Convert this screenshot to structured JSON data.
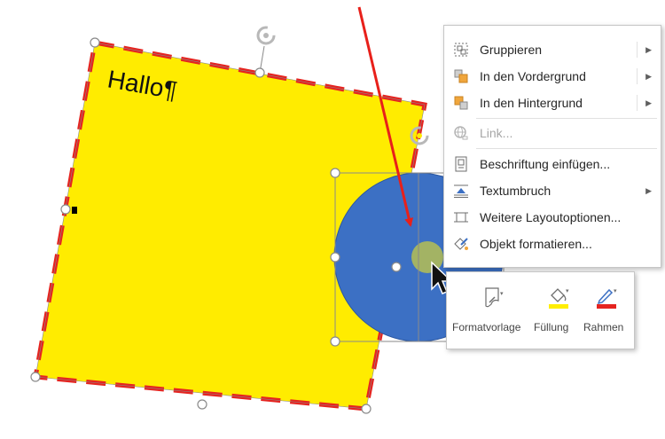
{
  "shape_text": "Hallo¶",
  "context_menu": {
    "items": [
      {
        "label": "Gruppieren",
        "submenu": true,
        "enabled": true
      },
      {
        "label": "In den Vordergrund",
        "submenu": true,
        "enabled": true
      },
      {
        "label": "In den Hintergrund",
        "submenu": true,
        "enabled": true
      },
      {
        "label": "Link...",
        "submenu": false,
        "enabled": false
      },
      {
        "label": "Beschriftung einfügen...",
        "submenu": false,
        "enabled": true
      },
      {
        "label": "Textumbruch",
        "submenu": true,
        "enabled": true
      },
      {
        "label": "Weitere Layoutoptionen...",
        "submenu": false,
        "enabled": true
      },
      {
        "label": "Objekt formatieren...",
        "submenu": false,
        "enabled": true
      }
    ]
  },
  "mini_toolbar": {
    "style_label": "Formatvorlage",
    "fill_label": "Füllung",
    "outline_label": "Rahmen"
  },
  "colors": {
    "square_fill": "#ffec00",
    "square_border": "#e52420",
    "circle_fill": "#3c70c4",
    "small_circle": "#a3b364",
    "arrow": "#e8201a",
    "fill_swatch": "#ffee00",
    "outline_swatch": "#e52420",
    "icon_orange": "#f0a63c",
    "icon_gray": "#6d6d6d"
  },
  "icons": {
    "rotate": "rotate-handle-icon",
    "group": "group-icon",
    "bring_forward": "bring-forward-icon",
    "send_backward": "send-backward-icon",
    "link": "link-icon",
    "caption": "insert-caption-icon",
    "wrap": "text-wrap-icon",
    "layout": "layout-options-icon",
    "format": "format-object-icon",
    "style": "shape-style-icon",
    "fill": "fill-bucket-icon",
    "outline": "pen-outline-icon"
  }
}
